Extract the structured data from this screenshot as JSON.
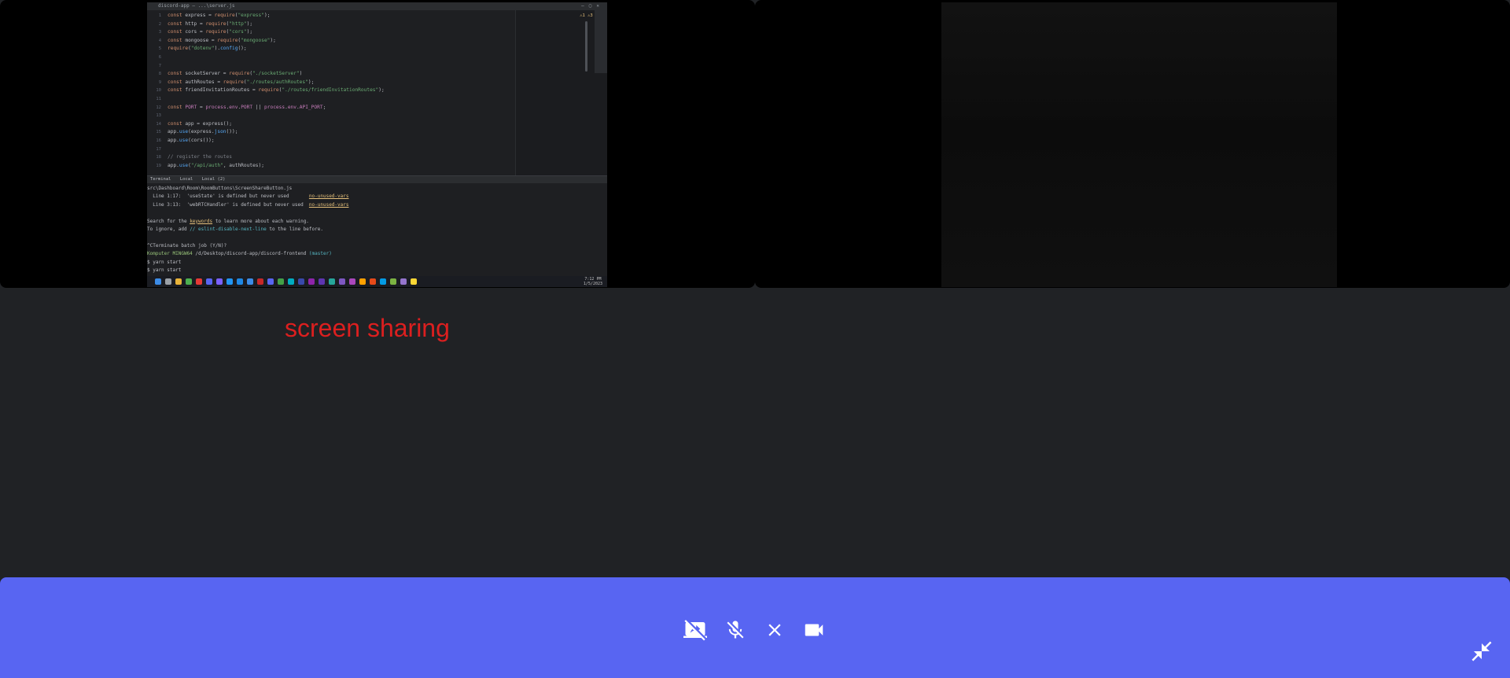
{
  "stage": {
    "caption": "screen sharing"
  },
  "shared_screen": {
    "window_title": "discord-app — ...\\server.js",
    "code_lines": [
      {
        "n": "1",
        "text": "const express = require(\"express\");"
      },
      {
        "n": "2",
        "text": "const http = require(\"http\");"
      },
      {
        "n": "3",
        "text": "const cors = require(\"cors\");"
      },
      {
        "n": "4",
        "text": "const mongoose = require(\"mongoose\");"
      },
      {
        "n": "5",
        "text": "require(\"dotenv\").config();"
      },
      {
        "n": "6",
        "text": ""
      },
      {
        "n": "7",
        "text": ""
      },
      {
        "n": "8",
        "text": "const socketServer = require(\"./socketServer\")"
      },
      {
        "n": "9",
        "text": "const authRoutes = require(\"./routes/authRoutes\");"
      },
      {
        "n": "10",
        "text": "const friendInvitationRoutes = require(\"./routes/friendInvitationRoutes\");"
      },
      {
        "n": "11",
        "text": ""
      },
      {
        "n": "12",
        "text": "const PORT = process.env.PORT || process.env.API_PORT;"
      },
      {
        "n": "13",
        "text": ""
      },
      {
        "n": "14",
        "text": "const app = express();"
      },
      {
        "n": "15",
        "text": "app.use(express.json());"
      },
      {
        "n": "16",
        "text": "app.use(cors());"
      },
      {
        "n": "17",
        "text": ""
      },
      {
        "n": "18",
        "text": "// register the routes"
      },
      {
        "n": "19",
        "text": "app.use(\"/api/auth\", authRoutes);"
      }
    ],
    "terminal_tabs": [
      "Terminal",
      "Local",
      "Local (2)"
    ],
    "terminal_lines": [
      "src\\Dashboard\\Room\\RoomButtons\\ScreenShareButton.js",
      "  Line 1:17:  'useState' is defined but never used       no-unused-vars",
      "  Line 3:13:  'webRTCHandler' is defined but never used  no-unused-vars",
      "",
      "Search for the keywords to learn more about each warning.",
      "To ignore, add // eslint-disable-next-line to the line before.",
      "",
      "^CTerminate batch job (Y/N)?",
      "Komputer MINGW64 /d/Desktop/discord-app/discord-frontend (master)",
      "$ yarn start",
      "$ yarn start"
    ],
    "clock": [
      "7:12 PM",
      "1/5/2023"
    ]
  },
  "controls": {
    "screen_share_icon": "stop-screen-share-icon",
    "mic_icon": "mic-off-icon",
    "leave_icon": "close-icon",
    "camera_icon": "videocam-icon",
    "minimize_icon": "close-fullscreen-icon"
  },
  "colors": {
    "background": "#202225",
    "control_bar": "#5865f2",
    "caption": "#dc1f1f",
    "icon": "#ffffff"
  }
}
